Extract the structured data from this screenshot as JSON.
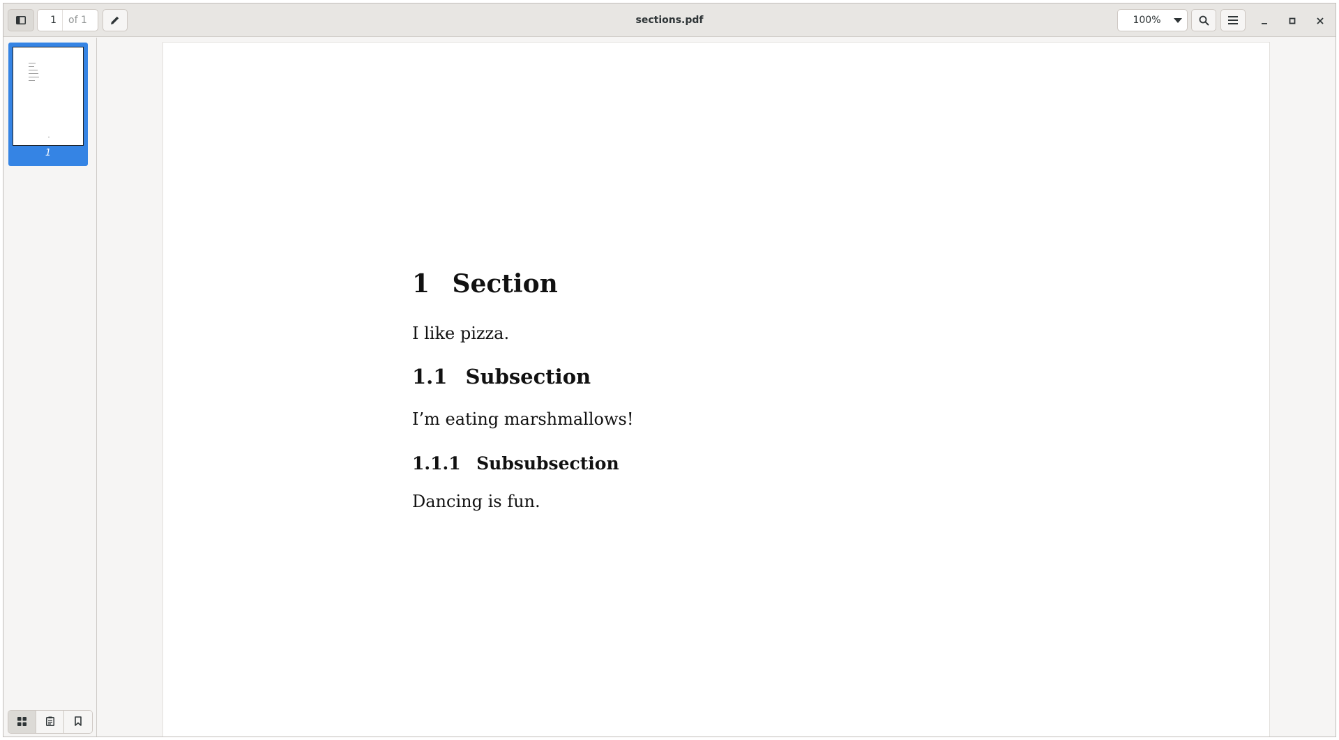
{
  "window": {
    "title": "sections.pdf"
  },
  "toolbar": {
    "current_page": "1",
    "page_total": "of 1",
    "zoom": "100%"
  },
  "sidebar": {
    "thumbnail_label": "1"
  },
  "document": {
    "section": {
      "number": "1",
      "title": "Section"
    },
    "section_text": "I like pizza.",
    "subsection": {
      "number": "1.1",
      "title": "Subsection"
    },
    "subsection_text": "I’m eating marshmallows!",
    "subsubsection": {
      "number": "1.1.1",
      "title": "Subsubsection"
    },
    "subsubsection_text": "Dancing is fun."
  },
  "colors": {
    "accent": "#3584e4",
    "headerbar": "#e8e6e3",
    "background": "#f6f5f4"
  }
}
